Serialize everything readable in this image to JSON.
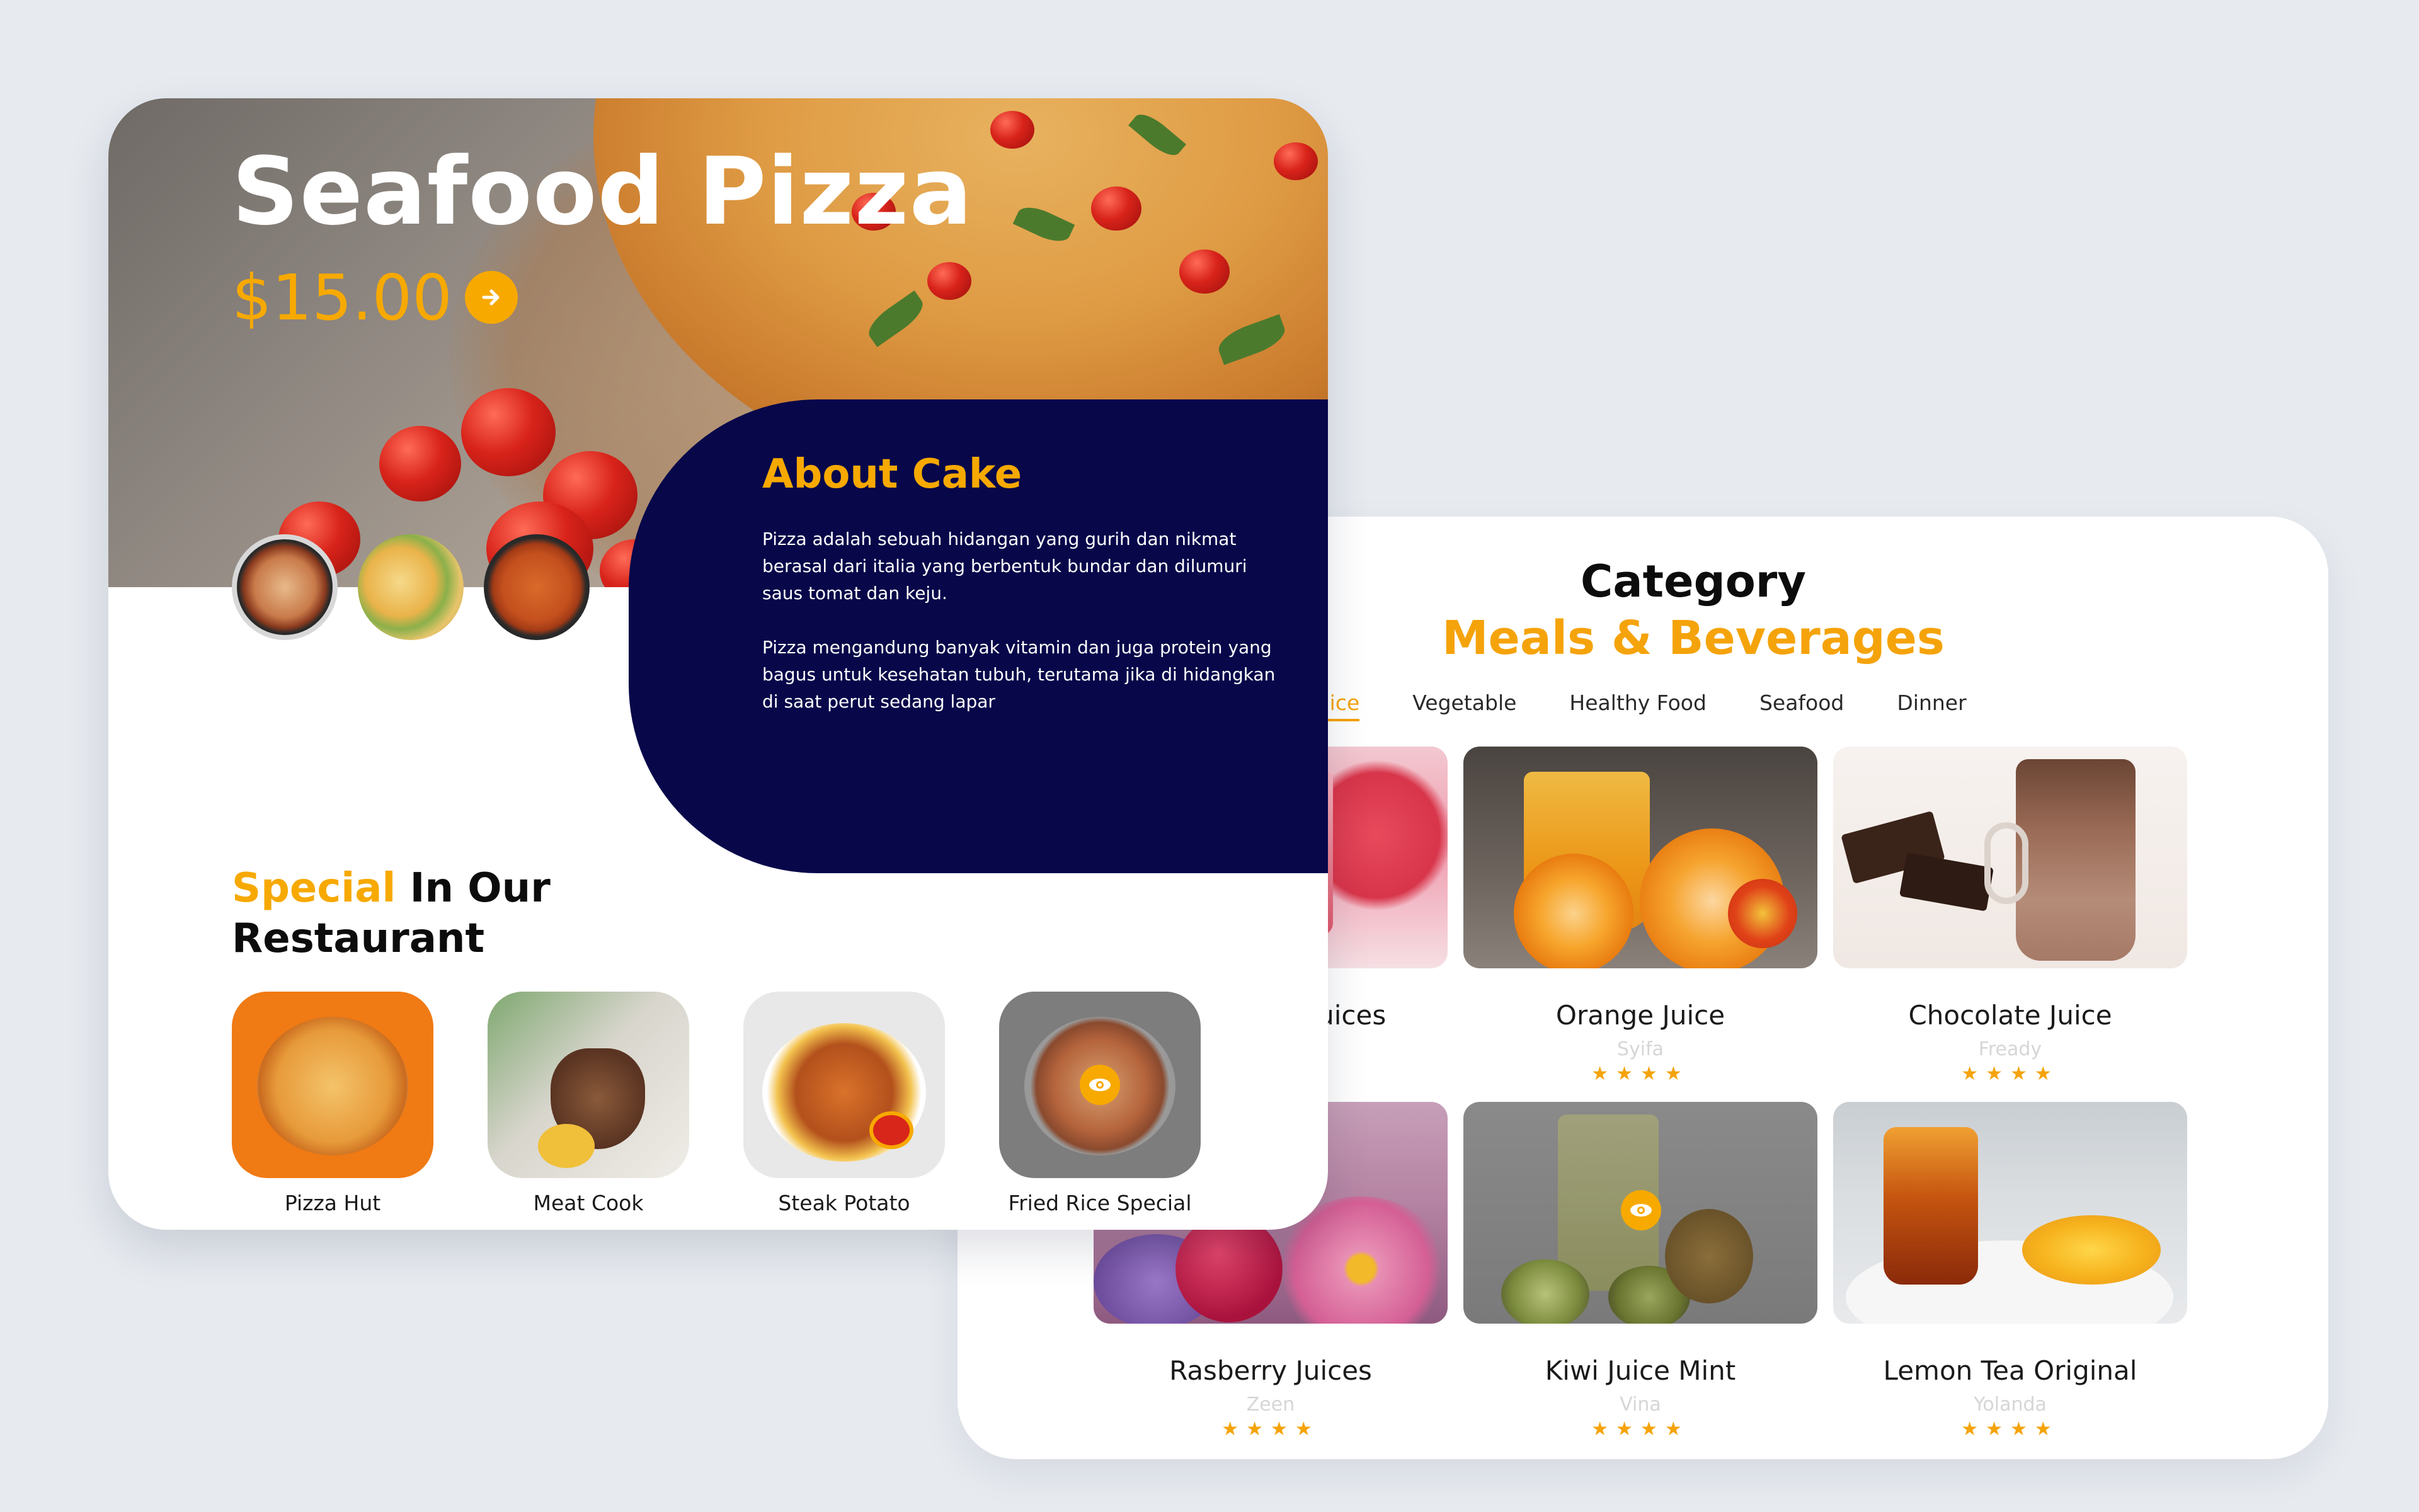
{
  "category_card": {
    "title": "Category",
    "subtitle": "Meals & Beverages",
    "tabs": [
      {
        "label": "Juice",
        "active": true
      },
      {
        "label": "Vegetable",
        "active": false
      },
      {
        "label": "Healthy Food",
        "active": false
      },
      {
        "label": "Seafood",
        "active": false
      },
      {
        "label": "Dinner",
        "active": false
      }
    ],
    "products": [
      {
        "name": "Strawberry Juices",
        "author": "",
        "rating": 4
      },
      {
        "name": "Orange Juice",
        "author": "Syifa",
        "rating": 4
      },
      {
        "name": "Chocolate Juice",
        "author": "Fready",
        "rating": 4
      },
      {
        "name": "Rasberry Juices",
        "author": "Zeen",
        "rating": 4
      },
      {
        "name": "Kiwi Juice Mint",
        "author": "Vina",
        "rating": 4
      },
      {
        "name": "Lemon Tea Original",
        "author": "Yolanda",
        "rating": 4
      }
    ],
    "stars_text": "★★★★"
  },
  "detail_card": {
    "product_title": "Seafood Pizza",
    "price": "$15.00",
    "about": {
      "title": "About Cake",
      "paragraph_1": "Pizza adalah sebuah hidangan yang gurih dan nikmat berasal dari italia yang berbentuk bundar dan dilumuri saus tomat dan keju.",
      "paragraph_2": "Pizza mengandung banyak vitamin dan juga protein yang bagus untuk kesehatan tubuh, terutama jika di hidangkan di saat perut sedang lapar"
    },
    "special_heading": {
      "accent": "Special",
      "rest_line1": "In Our",
      "rest_line2": "Restaurant"
    },
    "menu_items": [
      {
        "label": "Pizza Hut"
      },
      {
        "label": "Meat Cook"
      },
      {
        "label": "Steak Potato"
      },
      {
        "label": "Fried Rice Special"
      }
    ]
  },
  "colors": {
    "accent": "#f7a900",
    "navy": "#07074a",
    "background": "#e7ebf0"
  },
  "icons": [
    "arrow-right-icon",
    "eye-icon"
  ]
}
